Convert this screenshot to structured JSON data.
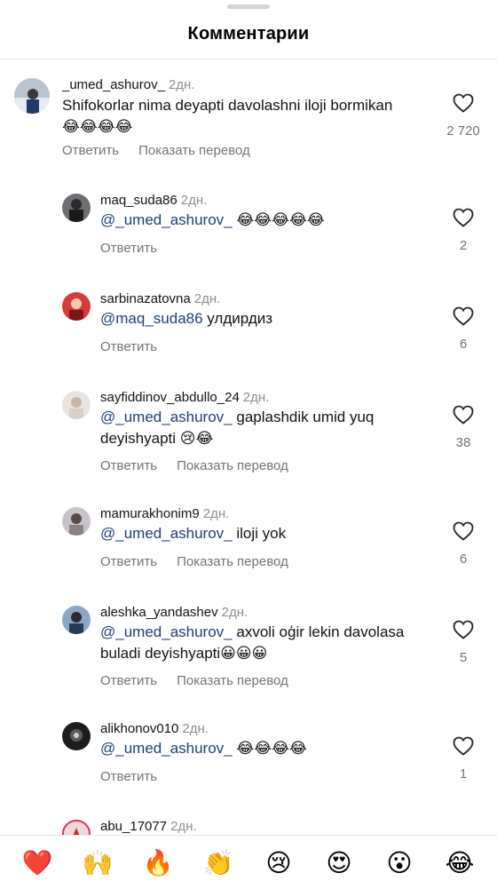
{
  "header": {
    "title": "Комментарии"
  },
  "comments": [
    {
      "username": "_umed_ashurov_",
      "time": "2дн.",
      "mention": "",
      "text": "Shifokorlar nima deyapti davolashni iloji bormikan",
      "emojis": "😂😂😂😂",
      "reply_label": "Ответить",
      "translate_label": "Показать перевод",
      "likes": "2 720"
    },
    {
      "username": "maq_suda86",
      "time": "2дн.",
      "mention": "@_umed_ashurov_",
      "text": "",
      "emojis": "😂😂😂😂😂",
      "reply_label": "Ответить",
      "translate_label": "",
      "likes": "2"
    },
    {
      "username": "sarbinazatovna",
      "time": "2дн.",
      "mention": "@maq_suda86",
      "text": "улдирдиз",
      "emojis": "",
      "reply_label": "Ответить",
      "translate_label": "",
      "likes": "6"
    },
    {
      "username": "sayfiddinov_abdullo_24",
      "time": "2дн.",
      "mention": "@_umed_ashurov_",
      "text": "gaplashdik umid yuq deyishyapti",
      "emojis": "😢😂",
      "reply_label": "Ответить",
      "translate_label": "Показать перевод",
      "likes": "38"
    },
    {
      "username": "mamurakhonim9",
      "time": "2дн.",
      "mention": "@_umed_ashurov_",
      "text": "iloji yok",
      "emojis": "",
      "reply_label": "Ответить",
      "translate_label": "Показать перевод",
      "likes": "6"
    },
    {
      "username": "aleshka_yandashev",
      "time": "2дн.",
      "mention": "@_umed_ashurov_",
      "text": "axvoli oģir lekin davolasa buladi deyishyapti",
      "emojis": "😀😀😀",
      "reply_label": "Ответить",
      "translate_label": "Показать перевод",
      "likes": "5"
    },
    {
      "username": "alikhonov010",
      "time": "2дн.",
      "mention": "@_umed_ashurov_",
      "text": "",
      "emojis": "😂😂😂😂",
      "reply_label": "Ответить",
      "translate_label": "",
      "likes": "1"
    },
    {
      "username": "abu_17077",
      "time": "2дн.",
      "mention": "",
      "text": "",
      "emojis": "",
      "reply_label": "",
      "translate_label": "",
      "likes": ""
    }
  ],
  "reactions": [
    "❤️",
    "🙌",
    "🔥",
    "👏",
    "😢",
    "😍",
    "😮",
    "😂"
  ],
  "colors": {
    "mention": "#1d3f73",
    "secondary": "#737373",
    "like_outline": "#262626"
  }
}
